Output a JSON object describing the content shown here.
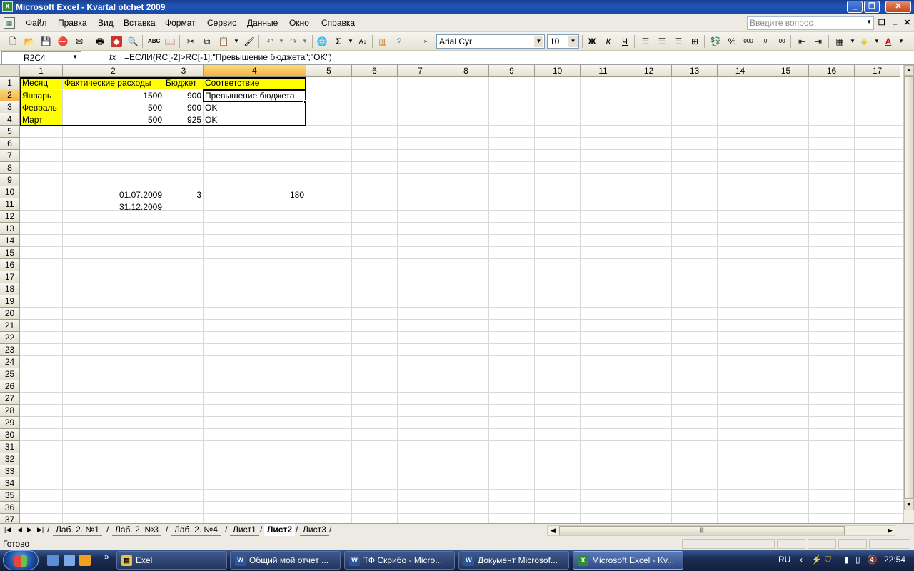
{
  "window": {
    "title": "Microsoft Excel - Kvartal otchet 2009"
  },
  "menu": {
    "items": [
      "Файл",
      "Правка",
      "Вид",
      "Вставка",
      "Формат",
      "Сервис",
      "Данные",
      "Окно",
      "Справка"
    ],
    "help_placeholder": "Введите вопрос"
  },
  "toolbar": {
    "font": "Arial Cyr",
    "size": "10"
  },
  "formula_bar": {
    "name_box": "R2C4",
    "fx": "fx",
    "formula": "=ЕСЛИ(RC[-2]>RC[-1];\"Превышение бюджета\";\"OK\")"
  },
  "grid": {
    "col_headers": [
      "1",
      "2",
      "3",
      "4",
      "5",
      "6",
      "7",
      "8",
      "9",
      "10",
      "11",
      "12",
      "13",
      "14",
      "15",
      "16",
      "17"
    ],
    "row_headers": [
      "1",
      "2",
      "3",
      "4",
      "5",
      "6",
      "7",
      "8",
      "9",
      "10",
      "11",
      "12",
      "13",
      "14",
      "15",
      "16",
      "17",
      "18",
      "19",
      "20",
      "21",
      "22",
      "23",
      "24",
      "25",
      "26",
      "27",
      "28",
      "29",
      "30",
      "31",
      "32",
      "33",
      "34",
      "35",
      "36",
      "37"
    ],
    "selected_col": "4",
    "selected_row": "2",
    "table": {
      "headers": [
        "Месяц",
        "Фактические расходы",
        "Бюджет",
        "Соответствие"
      ],
      "rows": [
        [
          "Январь",
          "1500",
          "900",
          "Превышение бюджета"
        ],
        [
          "Февраль",
          "500",
          "900",
          "OK"
        ],
        [
          "Март",
          "500",
          "925",
          "OK"
        ]
      ]
    },
    "extra": {
      "r10c2": "01.07.2009",
      "r10c3": "3",
      "r10c4": "180",
      "r11c2": "31.12.2009"
    }
  },
  "sheets": {
    "tabs": [
      "Лаб. 2. №1",
      "Лаб. 2. №3",
      "Лаб. 2. №4",
      "Лист1",
      "Лист2",
      "Лист3"
    ],
    "active": "Лист2"
  },
  "status": {
    "text": "Готово"
  },
  "taskbar": {
    "tasks": [
      "Exel",
      "Общий мой отчет ...",
      "ТФ Скрибо - Micro...",
      "Документ Microsof...",
      "Microsoft Excel - Kv..."
    ],
    "lang": "RU",
    "time": "22:54"
  },
  "colors": {
    "highlight": "#ffff00",
    "selected_header": "#f3b24a"
  }
}
